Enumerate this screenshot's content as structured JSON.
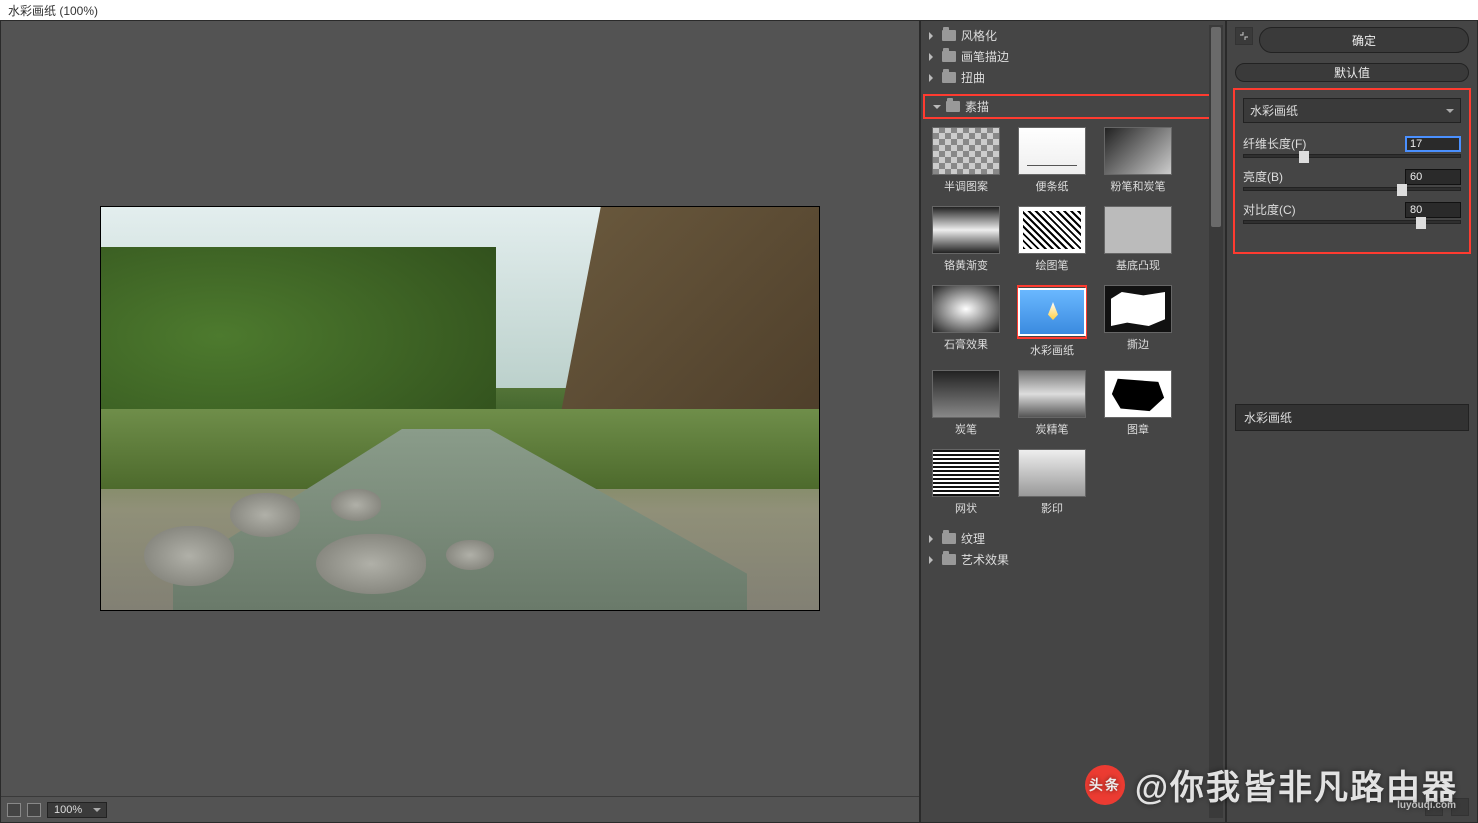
{
  "title": "水彩画纸 (100%)",
  "canvas": {
    "zoom": "100%"
  },
  "gallery": {
    "folders_top": [
      {
        "label": "风格化",
        "open": false
      },
      {
        "label": "画笔描边",
        "open": false
      },
      {
        "label": "扭曲",
        "open": false
      }
    ],
    "open_folder": {
      "label": "素描"
    },
    "thumbs": [
      {
        "id": "half",
        "label": "半调图案",
        "cls": "tb-checker"
      },
      {
        "id": "note",
        "label": "便条纸",
        "cls": "tb-note"
      },
      {
        "id": "chalk",
        "label": "粉笔和炭笔",
        "cls": "tb-chalk"
      },
      {
        "id": "chrome",
        "label": "铬黄渐变",
        "cls": "tb-chrome"
      },
      {
        "id": "graphic",
        "label": "绘图笔",
        "cls": "tb-graphic"
      },
      {
        "id": "relief",
        "label": "基底凸现",
        "cls": "tb-relief"
      },
      {
        "id": "plaster",
        "label": "石膏效果",
        "cls": "tb-plaster"
      },
      {
        "id": "water",
        "label": "水彩画纸",
        "cls": "tb-water",
        "selected": true
      },
      {
        "id": "torn",
        "label": "撕边",
        "cls": "tb-torn"
      },
      {
        "id": "char",
        "label": "炭笔",
        "cls": "tb-char"
      },
      {
        "id": "conte",
        "label": "炭精笔",
        "cls": "tb-conte"
      },
      {
        "id": "stamp",
        "label": "图章",
        "cls": "tb-stamp"
      },
      {
        "id": "retic",
        "label": "网状",
        "cls": "tb-retic"
      },
      {
        "id": "photoc",
        "label": "影印",
        "cls": "tb-photoc"
      }
    ],
    "folders_bottom": [
      {
        "label": "纹理",
        "open": false
      },
      {
        "label": "艺术效果",
        "open": false
      }
    ]
  },
  "controls": {
    "ok": "确定",
    "default": "默认值",
    "filter_name": "水彩画纸",
    "params": [
      {
        "label": "纤维长度(F)",
        "value": "17",
        "pos": 28,
        "active": true
      },
      {
        "label": "亮度(B)",
        "value": "60",
        "pos": 73
      },
      {
        "label": "对比度(C)",
        "value": "80",
        "pos": 82
      }
    ],
    "layer_entry": "水彩画纸"
  },
  "watermark": {
    "badge": "头条",
    "text": "@你我皆非凡路由器",
    "small": "luyouqi.com"
  }
}
